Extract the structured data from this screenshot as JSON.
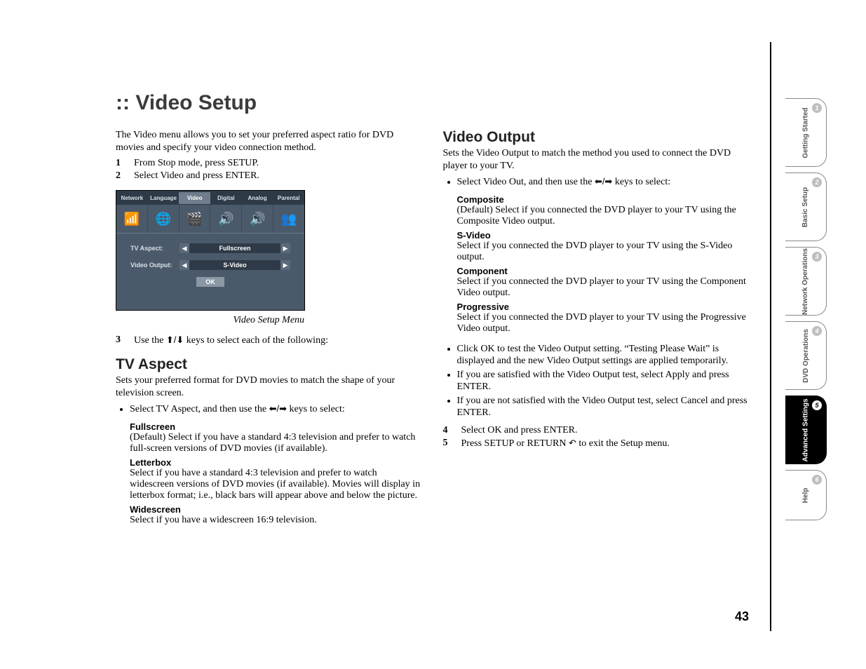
{
  "title": ":: Video Setup",
  "intro": "The Video menu allows you to set your preferred aspect ratio for DVD movies and specify your video connection method.",
  "steps_a": [
    "From Stop mode, press SETUP.",
    "Select Video and press ENTER."
  ],
  "screenshot": {
    "tabs": [
      "Network",
      "Language",
      "Video",
      "Digital",
      "Analog",
      "Parental"
    ],
    "active_tab_index": 2,
    "rows": [
      {
        "label": "TV Aspect:",
        "value": "Fullscreen"
      },
      {
        "label": "Video Output:",
        "value": "S-Video"
      }
    ],
    "ok": "OK",
    "caption": "Video Setup Menu"
  },
  "step3_num": "3",
  "step3_pre": "Use the ",
  "step3_post": " keys to select each of the following:",
  "tv_aspect": {
    "heading": "TV Aspect",
    "desc": "Sets your preferred format for DVD movies to match the shape of your television screen.",
    "select_pre": "Select TV Aspect, and then use the ",
    "select_post": " keys to select:",
    "options": [
      {
        "name": "Fullscreen",
        "text": "(Default) Select if you have a standard 4:3 television and prefer to watch full-screen versions of DVD movies (if available)."
      },
      {
        "name": "Letterbox",
        "text": "Select if you have a standard 4:3 television and prefer to watch widescreen versions of DVD movies (if available). Movies will display in letterbox format; i.e., black bars will appear above and below the picture."
      },
      {
        "name": "Widescreen",
        "text": "Select if you have a widescreen 16:9 television."
      }
    ]
  },
  "video_output": {
    "heading": "Video Output",
    "desc": "Sets the Video Output to match the method you used to connect the DVD player to your TV.",
    "select_pre": "Select Video Out, and then use the ",
    "select_post": " keys to select:",
    "options": [
      {
        "name": "Composite",
        "text": "(Default) Select if you connected the DVD player to your TV using the Composite Video output."
      },
      {
        "name": "S-Video",
        "text": "Select if you connected the DVD player to your TV using the S-Video output."
      },
      {
        "name": "Component",
        "text": "Select if you connected the DVD player to your TV using the Component Video output."
      },
      {
        "name": "Progressive",
        "text": "Select if you connected the DVD player to your TV using the Progressive Video output."
      }
    ],
    "post_bullets": [
      "Click OK to test the Video Output setting. “Testing Please Wait” is displayed and the new Video Output settings are applied temporarily.",
      "If you are satisfied with the Video Output test, select Apply and press ENTER.",
      "If you are not satisfied with the Video Output test, select Cancel and press ENTER."
    ],
    "final_steps": [
      {
        "num": "4",
        "text": "Select OK and press ENTER."
      },
      {
        "num": "5",
        "pre": "Press SETUP or RETURN ",
        "post": " to exit the Setup menu."
      }
    ]
  },
  "arrows": {
    "updown": "⬆/⬇",
    "leftright": "⬅/➡",
    "return": "↶"
  },
  "page_number": "43",
  "sidetabs": [
    {
      "num": "1",
      "label": "Getting\nStarted",
      "active": false
    },
    {
      "num": "2",
      "label": "Basic Setup",
      "active": false
    },
    {
      "num": "3",
      "label": "Network\nOperations",
      "active": false
    },
    {
      "num": "4",
      "label": "DVD\nOperations",
      "active": false
    },
    {
      "num": "5",
      "label": "Advanced\nSettings",
      "active": true
    },
    {
      "num": "6",
      "label": "Help",
      "active": false,
      "short": true
    }
  ]
}
